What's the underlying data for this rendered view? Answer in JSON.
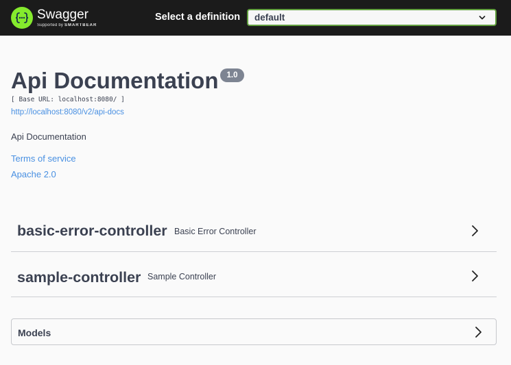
{
  "topbar": {
    "brand_name": "Swagger",
    "brand_sub_prefix": "Supported by",
    "brand_sub_company": "SMARTBEAR",
    "definition_label": "Select a definition",
    "definition_selected": "default"
  },
  "info": {
    "title": "Api Documentation",
    "version": "1.0",
    "base_url": "[ Base URL: localhost:8080/ ]",
    "api_docs_url": "http://localhost:8080/v2/api-docs",
    "description": "Api Documentation",
    "terms_of_service": "Terms of service",
    "license": "Apache 2.0"
  },
  "tags": [
    {
      "name": "basic-error-controller",
      "description": "Basic Error Controller"
    },
    {
      "name": "sample-controller",
      "description": "Sample Controller"
    }
  ],
  "models": {
    "title": "Models"
  },
  "colors": {
    "topbar_bg": "#1b1b1b",
    "brand_green": "#85ea2d",
    "select_border": "#62a03f",
    "link_blue": "#4990e2",
    "version_badge": "#7d8492",
    "text": "#3b4151"
  }
}
